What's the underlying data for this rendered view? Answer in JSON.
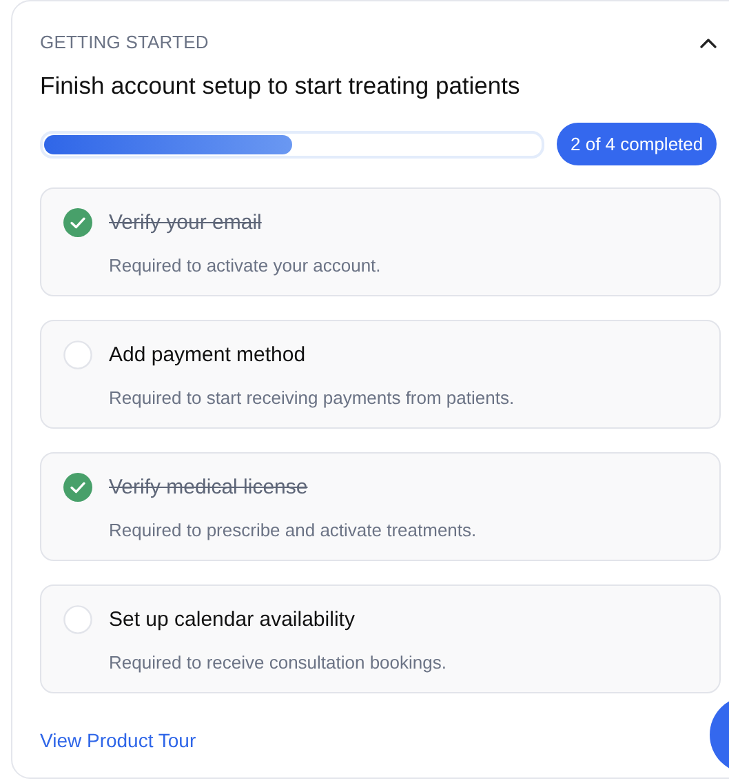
{
  "section_label": "GETTING STARTED",
  "expanded": true,
  "title": "Finish account setup to start treating patients",
  "progress": {
    "level": 0.5,
    "label": "2 of 4 completed"
  },
  "tasks": [
    {
      "title": "Verify your email",
      "description": "Required to activate your account.",
      "checked": true
    },
    {
      "title": "Add payment method",
      "description": "Required to start receiving payments from patients.",
      "checked": false
    },
    {
      "title": "Verify medical license",
      "description": "Required to prescribe and activate treatments.",
      "checked": true
    },
    {
      "title": "Set up calendar availability",
      "description": "Required to receive consultation bookings.",
      "checked": false
    }
  ],
  "link": "View Product Tour"
}
